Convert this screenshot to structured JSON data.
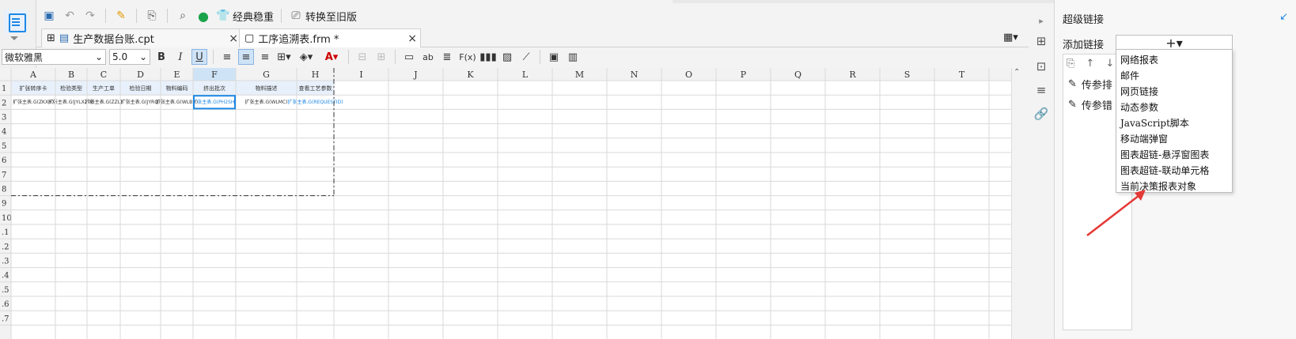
{
  "toolbar": {
    "classic_label": "经典稳重",
    "convert_label": "转换至旧版"
  },
  "tabs": [
    {
      "label": "生产数据台账.cpt",
      "close": "×"
    },
    {
      "label": "工序追溯表.frm *",
      "close": "×"
    }
  ],
  "format": {
    "font_name": "微软雅黑",
    "font_size": "5.0",
    "bold": "B",
    "italic": "I",
    "underline": "U",
    "ab": "ab",
    "fx": "F(x)",
    "text_color": "#cc0000"
  },
  "grid": {
    "columns": [
      "A",
      "B",
      "C",
      "D",
      "E",
      "F",
      "G",
      "H",
      "I",
      "J",
      "K",
      "L",
      "M",
      "N",
      "O",
      "P",
      "Q",
      "R",
      "S",
      "T"
    ],
    "rows": [
      "1",
      "2",
      "3",
      "4",
      "5",
      "6",
      "7",
      "8",
      "9",
      "10",
      "11",
      "12",
      "13",
      "14",
      "15",
      "16",
      "17"
    ],
    "row_labels_visible": [
      "1",
      "2",
      "3",
      "4",
      "5",
      "6",
      "7",
      "8",
      "9",
      "10",
      ".1",
      ".2",
      ".3",
      ".4",
      ".5",
      ".6",
      ".7"
    ],
    "header_cells": [
      "扩张转序卡",
      "检验类型",
      "生产工单",
      "检验日期",
      "物料编码",
      "挤出批次",
      "物料描述",
      "查看工艺参数"
    ],
    "data_cells": [
      "扩张主表.G(ZKXH)",
      "扩张主表.G(JYLXZW)",
      "扩张主表.G(ZZL)",
      "扩张主表.G(JYRQ)",
      "扩张主表.G(WLBH)",
      "扩张主表.G(PH2SH)",
      "扩张主表.G(WLMC)",
      "扩张主表.G(REQUESTID)"
    ],
    "selected_column": "F"
  },
  "right_panel": {
    "title": "超级链接",
    "add_label": "添加链接",
    "plus": "+▾",
    "list_items": [
      "传参排",
      "传参错"
    ],
    "menu_items": [
      "网络报表",
      "邮件",
      "网页链接",
      "动态参数",
      "JavaScript脚本",
      "移动端弹窗",
      "图表超链-悬浮窗图表",
      "图表超链-联动单元格",
      "当前决策报表对象"
    ]
  },
  "colors": {
    "accent": "#1e88e5",
    "arrow": "#e53935",
    "header_bg": "#e8f1fb",
    "selection": "#cfe3f7"
  }
}
